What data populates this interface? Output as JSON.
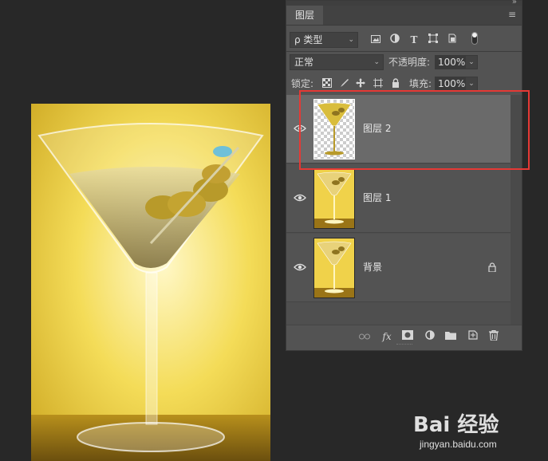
{
  "panel": {
    "tab_label": "图层",
    "menu_icon": "hamburger-menu-icon",
    "filter": {
      "kind_label": "ρ 类型",
      "icons": [
        "image-filter-icon",
        "adjustment-filter-icon",
        "type-filter-icon",
        "shape-filter-icon",
        "smart-object-filter-icon",
        "filter-toggle-icon"
      ]
    },
    "blend": {
      "mode": "正常",
      "opacity_label": "不透明度:",
      "opacity_value": "100%"
    },
    "lock": {
      "label": "锁定:",
      "icons": [
        "lock-transparent-pixels-icon",
        "lock-image-pixels-icon",
        "lock-position-icon",
        "lock-artboard-icon",
        "lock-all-icon"
      ],
      "fill_label": "填充:",
      "fill_value": "100%"
    },
    "layers": [
      {
        "name": "图层 2",
        "selected": true,
        "transparent_bg": true,
        "locked": false
      },
      {
        "name": "图层 1",
        "selected": false,
        "transparent_bg": false,
        "locked": false
      },
      {
        "name": "背景",
        "selected": false,
        "transparent_bg": false,
        "locked": true
      }
    ],
    "bottom_icons": [
      "link-layers-icon",
      "fx-icon",
      "add-mask-icon",
      "adjustment-layer-icon",
      "new-group-icon",
      "new-layer-icon",
      "delete-icon"
    ],
    "fx_label": "fx"
  },
  "watermark": {
    "logo_text": "Bai 经验",
    "url": "jingyan.baidu.com"
  },
  "colors": {
    "highlight": "#e53935",
    "panel_bg": "#535353",
    "selected_row": "#6a6a6a",
    "workspace": "#282828"
  }
}
